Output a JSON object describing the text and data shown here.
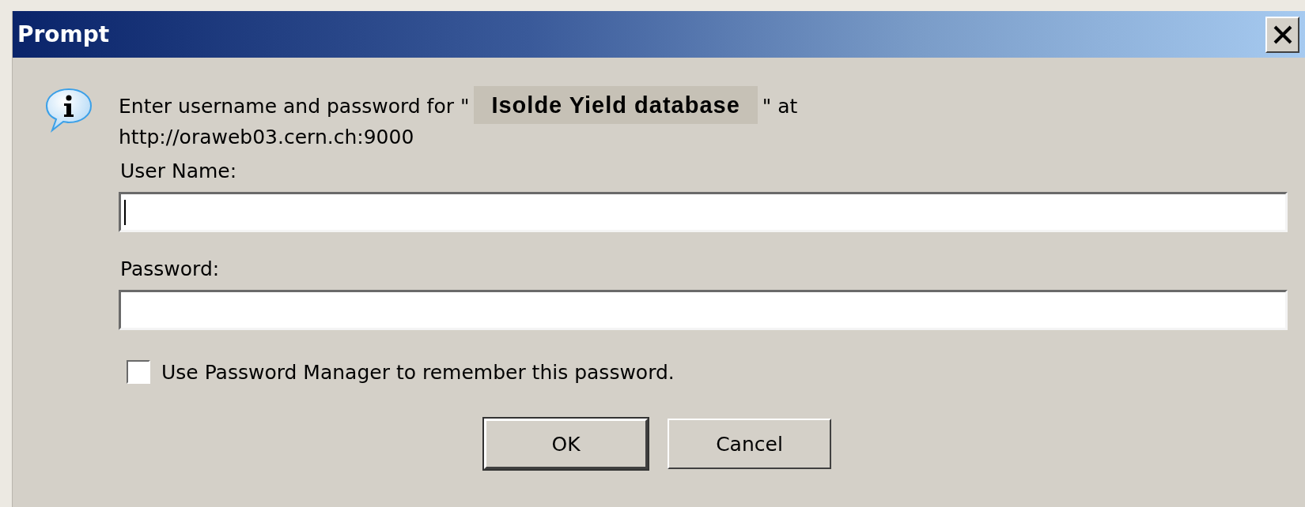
{
  "window": {
    "title": "Prompt"
  },
  "message": {
    "prefix": "Enter username and password for \"",
    "highlight": "Isolde Yield database",
    "suffix": "\" at",
    "url": "http://oraweb03.cern.ch:9000"
  },
  "fields": [
    {
      "label": "User Name:",
      "focused": true
    },
    {
      "label": "Password:",
      "focused": false
    }
  ],
  "checkbox": {
    "label": "Use Password Manager to remember this password.",
    "checked": false
  },
  "buttons": [
    {
      "label": "OK",
      "default": true
    },
    {
      "label": "Cancel",
      "default": false
    }
  ]
}
